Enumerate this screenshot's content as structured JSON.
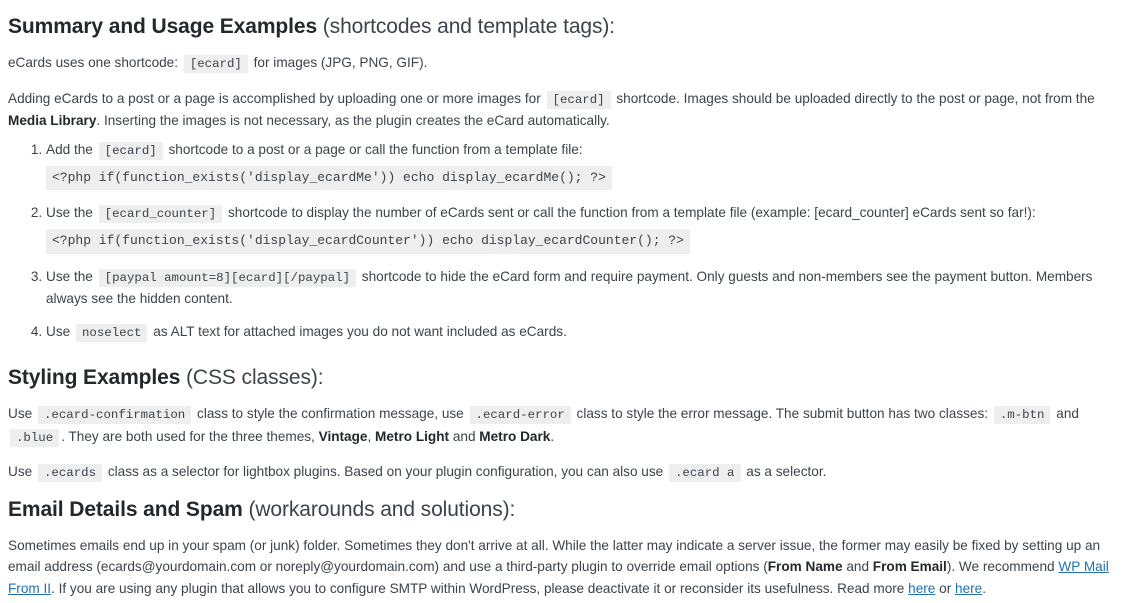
{
  "sections": [
    {
      "heading_main": "Summary and Usage Examples",
      "heading_sub": " (shortcodes and template tags):",
      "intro1_a": "eCards uses one shortcode:",
      "intro1_code": "[ecard]",
      "intro1_b": "for images (JPG, PNG, GIF).",
      "intro2_a": "Adding eCards to a post or a page is accomplished by uploading one or more images for",
      "intro2_code": "[ecard]",
      "intro2_b": "shortcode. Images should be uploaded directly to the post or page, not from the",
      "intro2_bold": "Media Library",
      "intro2_c": ". Inserting the images is not necessary, as the plugin creates the eCard automatically.",
      "steps": [
        {
          "text_a": "Add the",
          "code": "[ecard]",
          "text_b": "shortcode to a post or a page or call the function from a template file:",
          "code_block": "<?php if(function_exists('display_ecardMe')) echo display_ecardMe(); ?>"
        },
        {
          "text_a": "Use the",
          "code": "[ecard_counter]",
          "text_b": "shortcode to display the number of eCards sent or call the function from a template file (example: [ecard_counter] eCards sent so far!):",
          "code_block": "<?php if(function_exists('display_ecardCounter')) echo display_ecardCounter(); ?>"
        },
        {
          "text_a": "Use the",
          "code": "[paypal amount=8][ecard][/paypal]",
          "text_b": "shortcode to hide the eCard form and require payment. Only guests and non-members see the payment button. Members always see the hidden content.",
          "code_block": ""
        },
        {
          "text_a": "Use",
          "code": "noselect",
          "text_b": "as ALT text for attached images you do not want included as eCards.",
          "code_block": ""
        }
      ]
    }
  ],
  "styling": {
    "heading_main": "Styling Examples",
    "heading_sub": " (CSS classes):",
    "p1_a": "Use",
    "p1_code1": ".ecard-confirmation",
    "p1_b": "class to style the confirmation message, use",
    "p1_code2": ".ecard-error",
    "p1_c": "class to style the error message. The submit button has two classes:",
    "p1_code3": ".m-btn",
    "p1_d": "and",
    "p1_code4": ".blue",
    "p1_e": ". They are both used for the three themes,",
    "p1_bold1": "Vintage",
    "p1_f": ",",
    "p1_bold2": "Metro Light",
    "p1_g": "and",
    "p1_bold3": "Metro Dark",
    "p1_h": ".",
    "p2_a": "Use",
    "p2_code1": ".ecards",
    "p2_b": "class as a selector for lightbox plugins. Based on your plugin configuration, you can also use",
    "p2_code2": ".ecard a",
    "p2_c": "as a selector."
  },
  "email": {
    "heading_main": "Email Details and Spam",
    "heading_sub": " (workarounds and solutions):",
    "p1_a": "Sometimes emails end up in your spam (or junk) folder. Sometimes they don't arrive at all. While the latter may indicate a server issue, the former may easily be fixed by setting up an email address (ecards@yourdomain.com or noreply@yourdomain.com) and use a third-party plugin to override email options (",
    "p1_bold1": "From Name",
    "p1_b": "and",
    "p1_bold2": "From Email",
    "p1_c": "). We recommend",
    "p1_link1": "WP Mail From II",
    "p1_d": ". If you are using any plugin that allows you to configure SMTP within WordPress, please deactivate it or reconsider its usefulness. Read more",
    "p1_link2": "here",
    "p1_e": "or",
    "p1_link3": "here",
    "p1_f": "."
  },
  "colors": {
    "link": "#2271b1",
    "code_bg": "#eeeeee",
    "heading": "#23282d",
    "body": "#3c434a"
  }
}
